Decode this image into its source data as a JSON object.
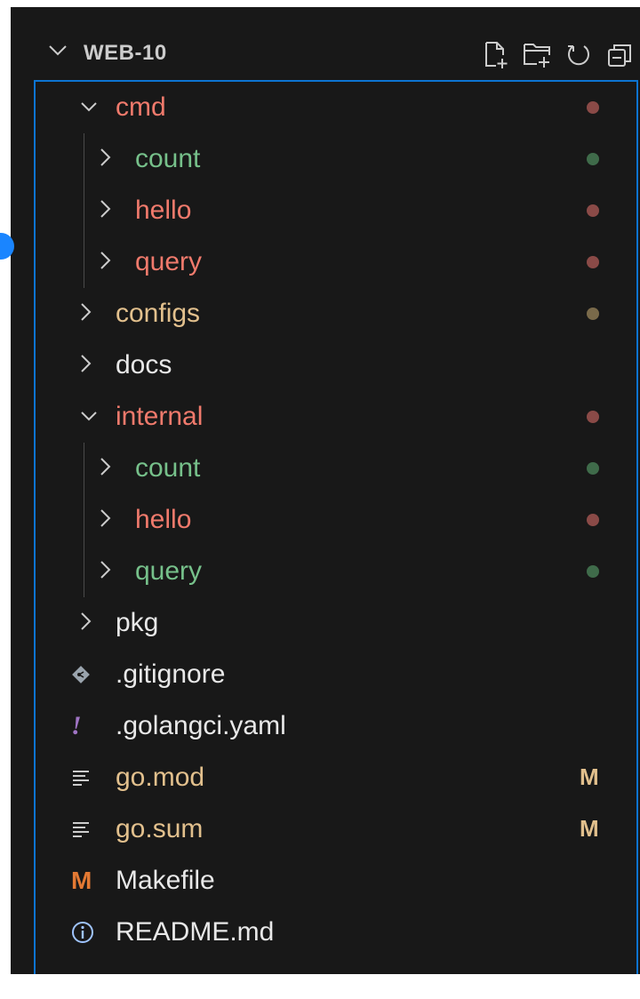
{
  "explorer": {
    "title": "WEB-10",
    "actions": [
      {
        "icon": "new-file-icon"
      },
      {
        "icon": "new-folder-icon"
      },
      {
        "icon": "refresh-icon"
      },
      {
        "icon": "collapse-all-icon"
      }
    ]
  },
  "colors": {
    "red": "#f07a6c",
    "green": "#76c08a",
    "yellow": "#e2c08d",
    "dot_red": "#8a4a47",
    "dot_green": "#3f6b4a",
    "dot_yellow": "#7a6a4a",
    "focus_border": "#0d74d1",
    "background": "#181818"
  },
  "tree": [
    {
      "label": "cmd",
      "depth": 0,
      "type": "folder",
      "expanded": true,
      "color": "red",
      "decoration": "dot-red"
    },
    {
      "label": "count",
      "depth": 1,
      "type": "folder",
      "expanded": false,
      "color": "green",
      "decoration": "dot-green"
    },
    {
      "label": "hello",
      "depth": 1,
      "type": "folder",
      "expanded": false,
      "color": "red",
      "decoration": "dot-red"
    },
    {
      "label": "query",
      "depth": 1,
      "type": "folder",
      "expanded": false,
      "color": "red",
      "decoration": "dot-red"
    },
    {
      "label": "configs",
      "depth": 0,
      "type": "folder",
      "expanded": false,
      "color": "yellow",
      "decoration": "dot-yellow"
    },
    {
      "label": "docs",
      "depth": 0,
      "type": "folder",
      "expanded": false,
      "color": "white",
      "decoration": ""
    },
    {
      "label": "internal",
      "depth": 0,
      "type": "folder",
      "expanded": true,
      "color": "red",
      "decoration": "dot-red"
    },
    {
      "label": "count",
      "depth": 1,
      "type": "folder",
      "expanded": false,
      "color": "green",
      "decoration": "dot-green"
    },
    {
      "label": "hello",
      "depth": 1,
      "type": "folder",
      "expanded": false,
      "color": "red",
      "decoration": "dot-red"
    },
    {
      "label": "query",
      "depth": 1,
      "type": "folder",
      "expanded": false,
      "color": "green",
      "decoration": "dot-green"
    },
    {
      "label": "pkg",
      "depth": 0,
      "type": "folder",
      "expanded": false,
      "color": "white",
      "decoration": ""
    },
    {
      "label": ".gitignore",
      "depth": 0,
      "type": "file",
      "icon": "git-icon",
      "color": "white",
      "decoration": ""
    },
    {
      "label": ".golangci.yaml",
      "depth": 0,
      "type": "file",
      "icon": "yaml-icon",
      "color": "white",
      "decoration": ""
    },
    {
      "label": "go.mod",
      "depth": 0,
      "type": "file",
      "icon": "text-lines-icon",
      "color": "yellow",
      "decoration": "M"
    },
    {
      "label": "go.sum",
      "depth": 0,
      "type": "file",
      "icon": "text-lines-icon",
      "color": "yellow",
      "decoration": "M"
    },
    {
      "label": "Makefile",
      "depth": 0,
      "type": "file",
      "icon": "makefile-icon",
      "color": "white",
      "decoration": ""
    },
    {
      "label": "README.md",
      "depth": 0,
      "type": "file",
      "icon": "info-icon",
      "color": "white",
      "decoration": ""
    }
  ]
}
